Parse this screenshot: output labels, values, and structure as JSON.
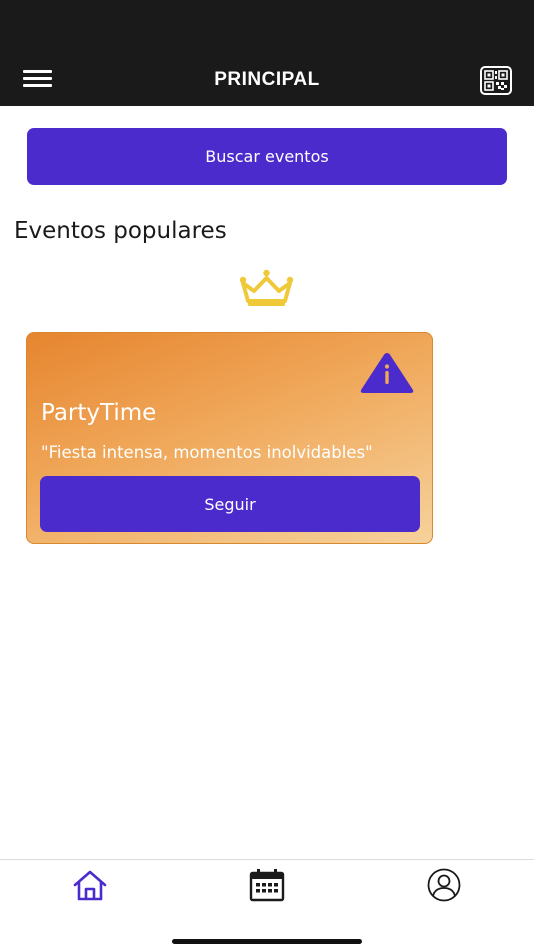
{
  "header": {
    "title": "PRINCIPAL",
    "menu_icon": "hamburger-menu-icon",
    "qr_icon": "qr-code-icon"
  },
  "search": {
    "button_label": "Buscar eventos"
  },
  "popular": {
    "title": "Eventos populares",
    "badge_icon": "crown-icon",
    "events": [
      {
        "name": "PartyTime",
        "description": "\"Fiesta intensa, momentos inolvidables\"",
        "follow_label": "Seguir",
        "status_icon": "warning-icon"
      }
    ]
  },
  "tabbar": {
    "items": [
      "home-icon",
      "calendar-icon",
      "profile-icon"
    ],
    "active": "home"
  },
  "colors": {
    "accent": "#4b2bcc",
    "header_bg": "#1a1a1a",
    "card_gradient_start": "#e6852f",
    "card_gradient_end": "#f6d29c",
    "crown": "#f0c93a"
  }
}
